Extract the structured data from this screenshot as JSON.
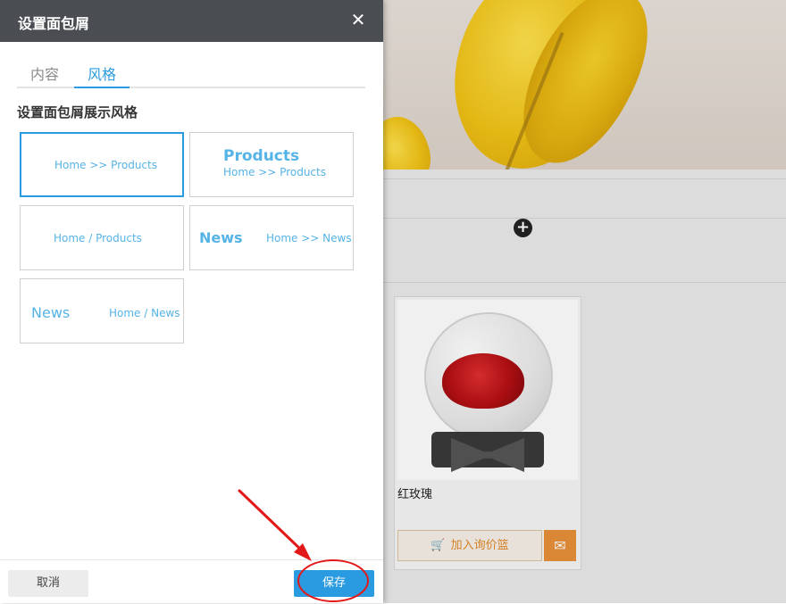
{
  "dialog": {
    "title": "设置面包屑",
    "tabs": [
      {
        "label": "内容",
        "active": false
      },
      {
        "label": "风格",
        "active": true
      }
    ],
    "section_label": "设置面包屑展示风格",
    "styles": [
      {
        "lines": [
          "Home >> Products"
        ],
        "selected": true
      },
      {
        "lines": [
          "Products",
          "Home >> Products"
        ],
        "selected": false
      },
      {
        "lines": [
          "Home / Products"
        ],
        "selected": false
      },
      {
        "lines": [
          "News",
          "Home >> News"
        ],
        "selected": false
      },
      {
        "lines": [
          "News",
          "Home / News"
        ],
        "selected": false
      }
    ],
    "cancel_label": "取消",
    "save_label": "保存",
    "close_icon": "close-icon"
  },
  "background": {
    "product": {
      "name": "红玫瑰",
      "cart_label": "加入询价篮",
      "cart_icon": "cart-icon",
      "mail_icon": "mail-icon"
    },
    "add_icon": "add-circle-icon"
  },
  "colors": {
    "accent": "#2a9be0",
    "header_bg": "#4a4e53",
    "style_text": "#56b3e6",
    "cart_orange": "#e8913a",
    "annotation_red": "#e31818"
  }
}
